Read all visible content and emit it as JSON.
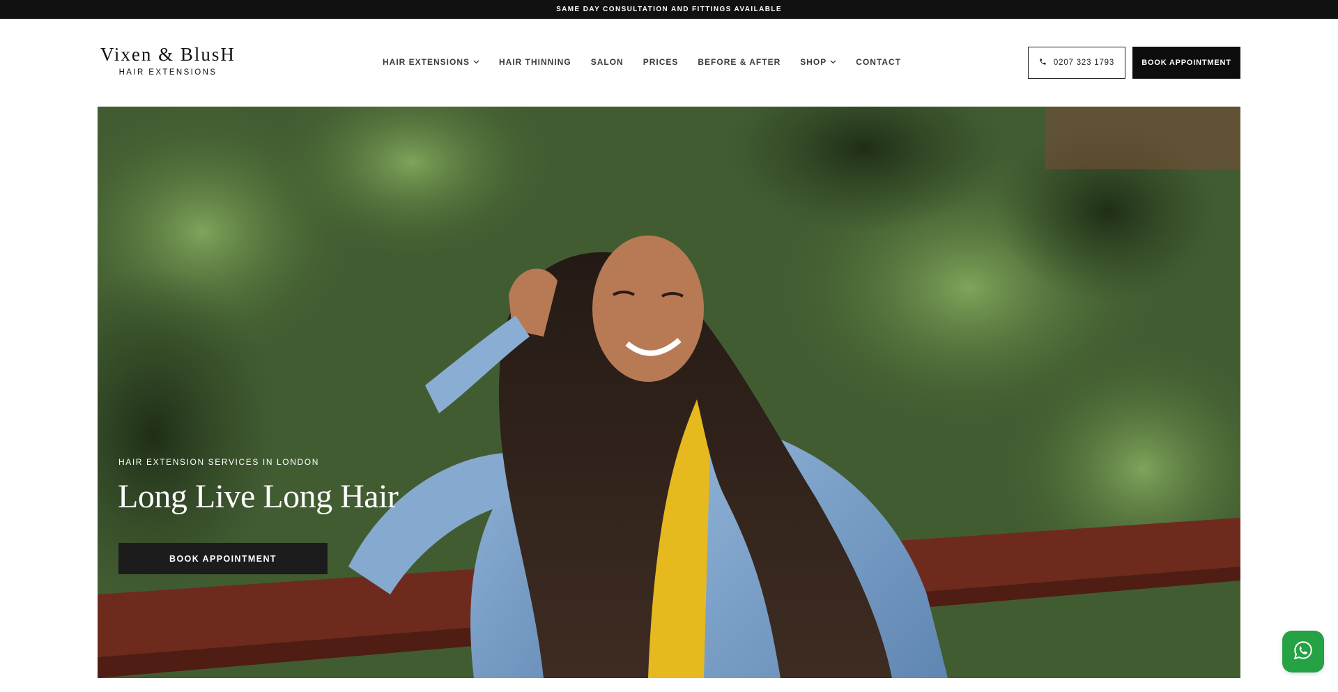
{
  "announcement": {
    "text": "SAME DAY CONSULTATION AND FITTINGS AVAILABLE"
  },
  "brand": {
    "name": "Vixen & BlusH",
    "subtitle": "HAIR EXTENSIONS"
  },
  "nav": {
    "items": [
      {
        "label": "HAIR EXTENSIONS",
        "has_dropdown": true
      },
      {
        "label": "HAIR THINNING",
        "has_dropdown": false
      },
      {
        "label": "SALON",
        "has_dropdown": false
      },
      {
        "label": "PRICES",
        "has_dropdown": false
      },
      {
        "label": "BEFORE & AFTER",
        "has_dropdown": false
      },
      {
        "label": "SHOP",
        "has_dropdown": true
      },
      {
        "label": "CONTACT",
        "has_dropdown": false
      }
    ]
  },
  "header_actions": {
    "phone": "0207 323 1793",
    "phone_icon": "phone-icon",
    "book_label": "BOOK APPOINTMENT"
  },
  "hero": {
    "eyebrow": "HAIR EXTENSION SERVICES IN LONDON",
    "title": "Long Live Long Hair",
    "cta_label": "BOOK APPOINTMENT"
  },
  "chat": {
    "icon": "whatsapp-icon",
    "color": "#25a244"
  },
  "colors": {
    "topbar": "#111111",
    "button_dark": "#0d0d0d",
    "hero_button": "#1c1c1c"
  }
}
